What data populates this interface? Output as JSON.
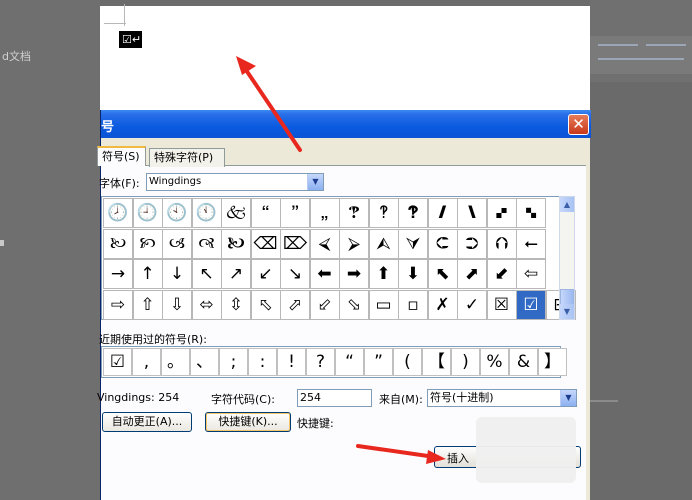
{
  "background": {
    "doc_label": "d文档"
  },
  "document": {
    "inserted_glyph": "☑↵"
  },
  "dialog": {
    "title": "号",
    "close_glyph": "✕",
    "tabs": [
      {
        "label": "符号(S)",
        "selected": true
      },
      {
        "label": "特殊字符(P)",
        "selected": false
      }
    ],
    "font_label": "字体(F):",
    "font_value": "Wingdings",
    "grid_rows": [
      [
        "🕗",
        "🕘",
        "🕙",
        "🕚",
        "🙵",
        "🙶",
        "🙷",
        "🙸",
        "🙹",
        "🙺",
        "🙻",
        "🙼",
        "🙽",
        "🙾",
        "🙿"
      ],
      [
        "🙠",
        "🙡",
        "🙢",
        "🙣",
        "🙤",
        "⌫",
        "⌦",
        "⮘",
        "⮚",
        "⮙",
        "⮛",
        "⮈",
        "⮊",
        "⮉",
        "⭠"
      ],
      [
        "→",
        "↑",
        "↓",
        "↖",
        "↗",
        "↙",
        "↘",
        "⬅",
        "➡",
        "⬆",
        "⬇",
        "⬉",
        "⬈",
        "⬋",
        "⇦"
      ],
      [
        "⇨",
        "⇧",
        "⇩",
        "⬄",
        "⇳",
        "⬁",
        "⬀",
        "⬃",
        "⬂",
        "▭",
        "▫",
        "✗",
        "✓",
        "☒",
        "☑",
        "⊞"
      ]
    ],
    "selected_symbol": "☑",
    "recent_label": "近期使用过的符号(R):",
    "recent_symbols": [
      "☑",
      ",",
      "。",
      "、",
      ";",
      ":",
      "!",
      "?",
      "“",
      "”",
      "(",
      "【",
      ")",
      "%",
      "&",
      "】"
    ],
    "font_code_text": "Vingdings: 254",
    "char_code_label": "字符代码(C):",
    "char_code_value": "254",
    "from_label": "来自(M):",
    "from_value": "符号(十进制)",
    "autocorrect_label": "自动更正(A)...",
    "shortcut_btn_label": "快捷键(K)...",
    "shortcut_label": "快捷键:",
    "insert_label": "插入"
  },
  "colors": {
    "title_blue": "#0b55d4",
    "selection_blue": "#316ac5",
    "arrow_red": "#e8281e"
  }
}
